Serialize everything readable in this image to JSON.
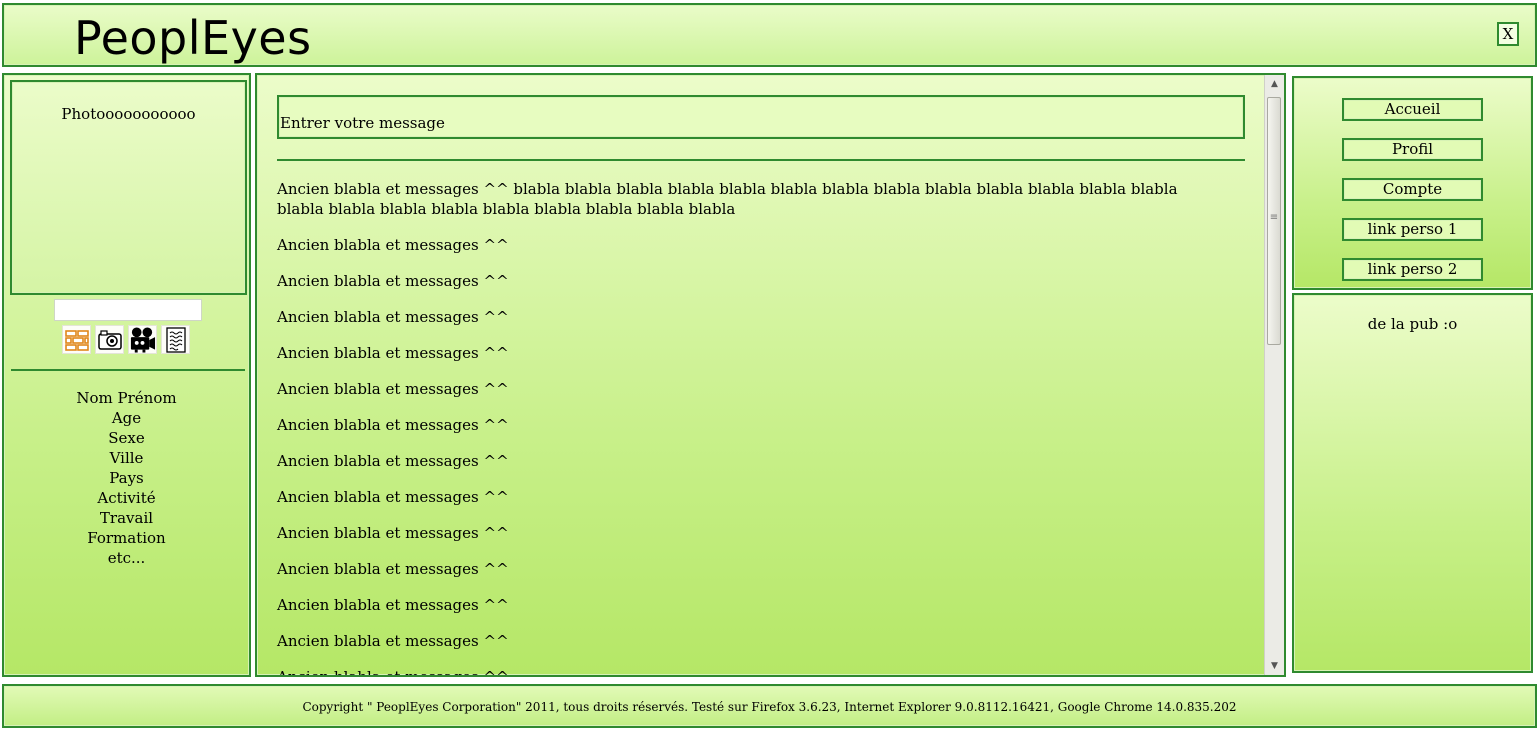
{
  "header": {
    "title": "PeoplEyes",
    "close_label": "X"
  },
  "left": {
    "photo_label": "Photooooooooooo",
    "search_value": "",
    "media_icons": [
      "wall-icon",
      "photo-camera-icon",
      "video-camera-icon",
      "notes-icon"
    ],
    "profile_fields": [
      "Nom Prénom",
      "Age",
      "Sexe",
      "Ville",
      "Pays",
      "Activité",
      "Travail",
      "Formation",
      "etc..."
    ]
  },
  "center": {
    "message_placeholder": "Entrer votre message",
    "first_message": "Ancien blabla et messages ^^ blabla blabla blabla blabla blabla blabla blabla blabla blabla blabla blabla blabla blabla blabla blabla blabla blabla blabla blabla blabla blabla blabla",
    "messages": [
      "Ancien blabla et messages ^^",
      "Ancien blabla et messages ^^",
      "Ancien blabla et messages ^^",
      "Ancien blabla et messages ^^",
      "Ancien blabla et messages ^^",
      "Ancien blabla et messages ^^",
      "Ancien blabla et messages ^^",
      "Ancien blabla et messages ^^",
      "Ancien blabla et messages ^^",
      "Ancien blabla et messages ^^",
      "Ancien blabla et messages ^^",
      "Ancien blabla et messages ^^",
      "Ancien blabla et messages ^^"
    ]
  },
  "right": {
    "nav": [
      "Accueil",
      "Profil",
      "Compte",
      "link perso 1",
      "link perso 2"
    ],
    "ad_text": "de la pub :o"
  },
  "footer": {
    "text": "Copyright \" PeoplEyes Corporation\" 2011, tous droits réservés. Testé sur Firefox 3.6.23, Internet Explorer 9.0.8112.16421, Google Chrome 14.0.835.202"
  },
  "colors": {
    "border": "#2f8a2f",
    "gradient_top": "#ecfcca",
    "gradient_bottom": "#b5e766"
  }
}
